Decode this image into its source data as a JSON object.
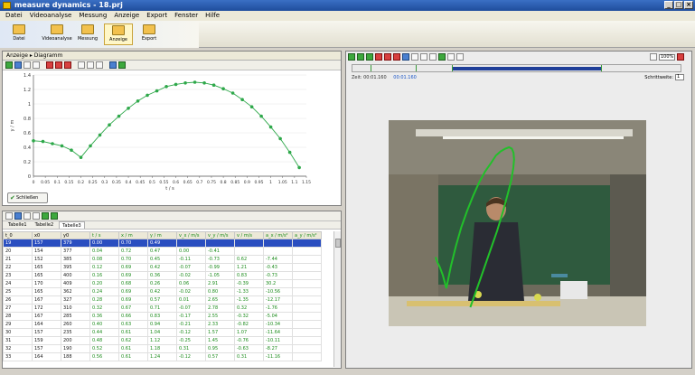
{
  "window": {
    "title": "measure dynamics - 18.prj"
  },
  "menu": [
    "Datei",
    "Videoanalyse",
    "Messung",
    "Anzeige",
    "Export",
    "Fenster",
    "Hilfe"
  ],
  "toolbar": {
    "buttons": [
      {
        "label": "Datei",
        "active": false
      },
      {
        "label": "Videoanalyse",
        "active": false
      },
      {
        "label": "Messung",
        "active": false
      },
      {
        "label": "Anzeige",
        "active": true
      },
      {
        "label": "Export",
        "active": false
      }
    ]
  },
  "diagram_pane": {
    "header": "Anzeige ▸ Diagramm",
    "button_label": "Schließen"
  },
  "chart_data": {
    "type": "line",
    "xlabel": "t / s",
    "ylabel": "y / m",
    "xlim": [
      0,
      1.15
    ],
    "ylim": [
      0,
      1.4
    ],
    "x_ticks": [
      "0",
      "0.05",
      "0.1",
      "0.15",
      "0.2",
      "0.25",
      "0.3",
      "0.35",
      "0.4",
      "0.45",
      "0.5",
      "0.55",
      "0.6",
      "0.65",
      "0.7",
      "0.75",
      "0.8",
      "0.85",
      "0.9",
      "0.95",
      "1",
      "1.05",
      "1.1",
      "1.15"
    ],
    "y_ticks": [
      "0",
      "0.2",
      "0.4",
      "0.6",
      "0.8",
      "1",
      "1.2",
      "1.4"
    ],
    "color": "#2ea84a",
    "series": [
      {
        "x": [
          0.0,
          0.04,
          0.08,
          0.12,
          0.16,
          0.2,
          0.24,
          0.28,
          0.32,
          0.36,
          0.4,
          0.44,
          0.48,
          0.52,
          0.56,
          0.6,
          0.64,
          0.68,
          0.72,
          0.76,
          0.8,
          0.84,
          0.88,
          0.92,
          0.96,
          1.0,
          1.04,
          1.08,
          1.12
        ],
        "y": [
          0.49,
          0.48,
          0.45,
          0.42,
          0.36,
          0.26,
          0.42,
          0.57,
          0.71,
          0.83,
          0.94,
          1.04,
          1.12,
          1.18,
          1.24,
          1.27,
          1.29,
          1.3,
          1.29,
          1.26,
          1.21,
          1.15,
          1.06,
          0.96,
          0.83,
          0.68,
          0.52,
          0.33,
          0.12
        ]
      }
    ]
  },
  "table_pane": {
    "tabs": [
      "Tabelle1",
      "Tabelle2",
      "Tabelle3"
    ],
    "columns": [
      "t_0",
      "x0",
      "y0",
      "t / s",
      "x / m",
      "y / m",
      "v_x / m/s",
      "v_y / m/s",
      "v / m/s",
      "a_x / m/s²",
      "a_y / m/s²"
    ],
    "rows": [
      [
        "19",
        "157",
        "379",
        "0.00",
        "0.70",
        "0.49",
        "",
        "",
        "",
        "",
        ""
      ],
      [
        "20",
        "154",
        "377",
        "0.04",
        "0.72",
        "0.47",
        "0.00",
        "-0.41",
        "",
        "",
        ""
      ],
      [
        "21",
        "152",
        "385",
        "0.08",
        "0.70",
        "0.45",
        "-0.11",
        "-0.73",
        "0.62",
        "-7.44",
        ""
      ],
      [
        "22",
        "165",
        "395",
        "0.12",
        "0.69",
        "0.42",
        "-0.07",
        "-0.99",
        "1.21",
        "-0.43",
        ""
      ],
      [
        "23",
        "165",
        "400",
        "0.16",
        "0.69",
        "0.36",
        "-0.02",
        "-1.05",
        "0.83",
        "-0.73",
        ""
      ],
      [
        "24",
        "170",
        "409",
        "0.20",
        "0.68",
        "0.26",
        "0.06",
        "2.91",
        "-0.39",
        "30.2",
        ""
      ],
      [
        "25",
        "165",
        "362",
        "0.24",
        "0.69",
        "0.42",
        "-0.02",
        "0.80",
        "-1.33",
        "-10.56",
        ""
      ],
      [
        "26",
        "167",
        "327",
        "0.28",
        "0.69",
        "0.57",
        "0.01",
        "2.65",
        "-1.35",
        "-12.17",
        ""
      ],
      [
        "27",
        "172",
        "310",
        "0.32",
        "0.67",
        "0.71",
        "-0.07",
        "2.78",
        "0.32",
        "-1.76",
        ""
      ],
      [
        "28",
        "167",
        "285",
        "0.36",
        "0.66",
        "0.83",
        "-0.17",
        "2.55",
        "-0.32",
        "-5.04",
        ""
      ],
      [
        "29",
        "164",
        "260",
        "0.40",
        "0.63",
        "0.94",
        "-0.21",
        "2.33",
        "-0.82",
        "-10.34",
        ""
      ],
      [
        "30",
        "157",
        "235",
        "0.44",
        "0.61",
        "1.04",
        "-0.12",
        "1.57",
        "1.07",
        "-11.64",
        ""
      ],
      [
        "31",
        "159",
        "200",
        "0.48",
        "0.62",
        "1.12",
        "-0.25",
        "1.45",
        "-0.76",
        "-10.11",
        ""
      ],
      [
        "32",
        "157",
        "190",
        "0.52",
        "0.61",
        "1.18",
        "0.31",
        "0.95",
        "-0.63",
        "-8.27",
        ""
      ],
      [
        "33",
        "164",
        "188",
        "0.56",
        "0.61",
        "1.24",
        "-0.12",
        "0.57",
        "0.31",
        "-11.16",
        ""
      ]
    ]
  },
  "video_pane": {
    "time_label": "Zeit: 00:01.160",
    "time_value": "00:01.160",
    "step_label": "Schrittweite:",
    "step_value": "1",
    "zoom_value": "100%"
  }
}
